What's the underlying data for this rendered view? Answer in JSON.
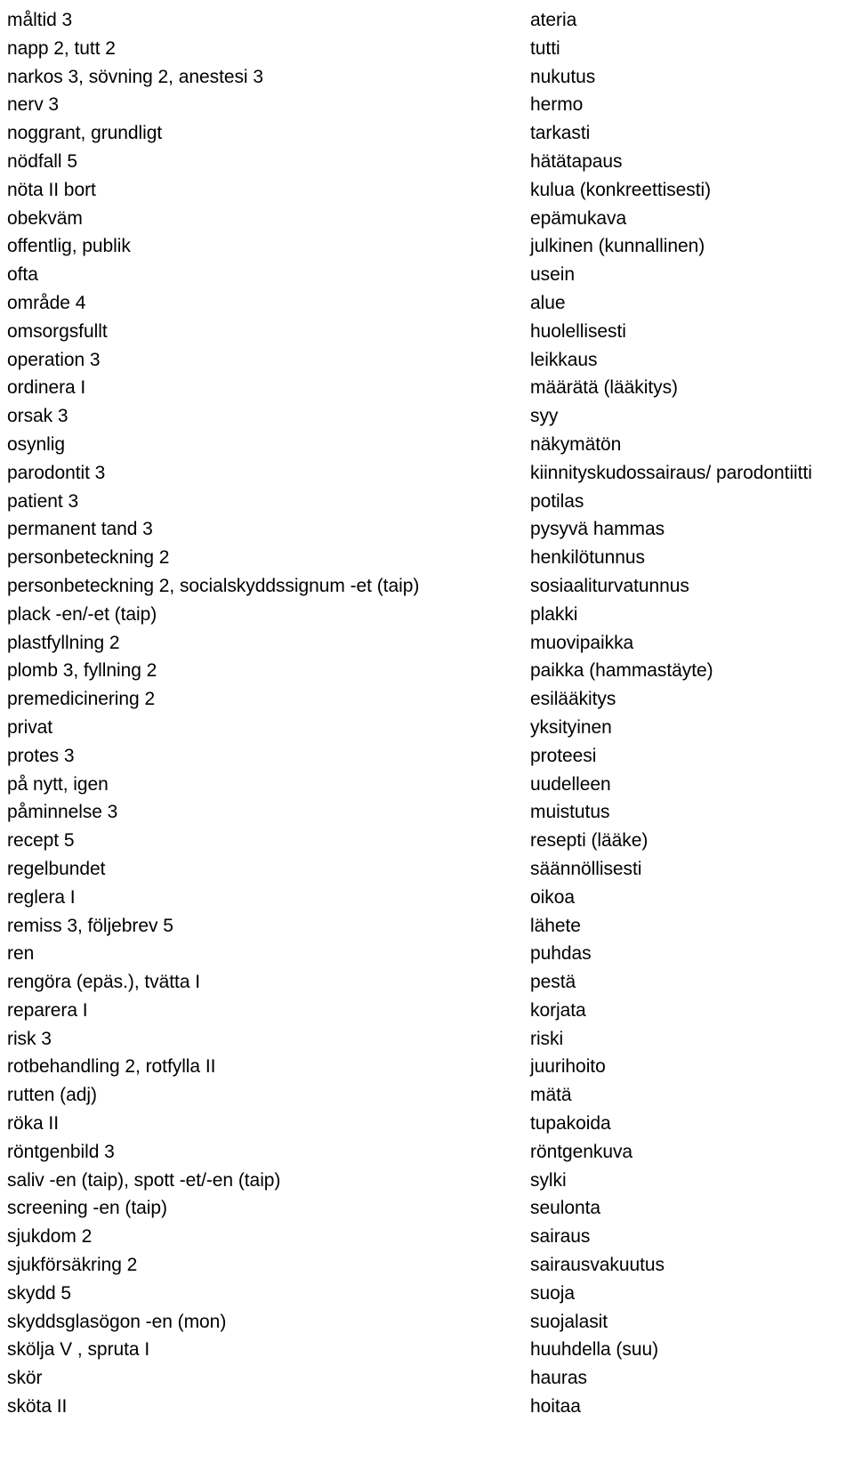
{
  "document": {
    "type": "bilingual-glossary",
    "source_language": "Swedish",
    "target_language": "Finnish",
    "columns": [
      "term",
      "translation"
    ],
    "rows": [
      {
        "term": "måltid 3",
        "translation": "ateria"
      },
      {
        "term": "napp 2, tutt 2",
        "translation": "tutti"
      },
      {
        "term": "narkos 3, sövning 2, anestesi 3",
        "translation": "nukutus"
      },
      {
        "term": "nerv 3",
        "translation": "hermo"
      },
      {
        "term": "noggrant, grundligt",
        "translation": "tarkasti"
      },
      {
        "term": "nödfall 5",
        "translation": "hätätapaus"
      },
      {
        "term": "nöta II bort",
        "translation": "kulua (konkreettisesti)"
      },
      {
        "term": "obekväm",
        "translation": "epämukava"
      },
      {
        "term": "offentlig, publik",
        "translation": "julkinen (kunnallinen)"
      },
      {
        "term": "ofta",
        "translation": "usein"
      },
      {
        "term": "område 4",
        "translation": "alue"
      },
      {
        "term": "omsorgsfullt",
        "translation": "huolellisesti"
      },
      {
        "term": "operation 3",
        "translation": "leikkaus"
      },
      {
        "term": "ordinera I",
        "translation": "määrätä (lääkitys)"
      },
      {
        "term": "orsak 3",
        "translation": "syy"
      },
      {
        "term": "osynlig",
        "translation": "näkymätön"
      },
      {
        "term": "parodontit 3",
        "translation": "kiinnityskudossairaus/ parodontiitti"
      },
      {
        "term": "patient 3",
        "translation": "potilas"
      },
      {
        "term": "permanent tand 3",
        "translation": "pysyvä hammas"
      },
      {
        "term": "personbeteckning 2",
        "translation": "henkilötunnus"
      },
      {
        "term": "personbeteckning 2, socialskyddssignum -et (taip)",
        "translation": "sosiaaliturvatunnus"
      },
      {
        "term": "plack -en/-et (taip)",
        "translation": "plakki"
      },
      {
        "term": "plastfyllning 2",
        "translation": "muovipaikka"
      },
      {
        "term": "plomb 3, fyllning 2",
        "translation": "paikka (hammastäyte)"
      },
      {
        "term": "premedicinering 2",
        "translation": "esilääkitys"
      },
      {
        "term": "privat",
        "translation": "yksityinen"
      },
      {
        "term": "protes 3",
        "translation": "proteesi"
      },
      {
        "term": "på nytt, igen",
        "translation": "uudelleen"
      },
      {
        "term": "påminnelse 3",
        "translation": "muistutus"
      },
      {
        "term": "recept 5",
        "translation": "resepti (lääke)"
      },
      {
        "term": "regelbundet",
        "translation": "säännöllisesti"
      },
      {
        "term": "reglera I",
        "translation": "oikoa"
      },
      {
        "term": "remiss 3, följebrev 5",
        "translation": "lähete"
      },
      {
        "term": "ren",
        "translation": "puhdas"
      },
      {
        "term": "rengöra (epäs.), tvätta I",
        "translation": "pestä"
      },
      {
        "term": "reparera I",
        "translation": "korjata"
      },
      {
        "term": "risk 3",
        "translation": "riski"
      },
      {
        "term": "rotbehandling 2, rotfylla II",
        "translation": "juurihoito"
      },
      {
        "term": "rutten (adj)",
        "translation": "mätä"
      },
      {
        "term": "röka II",
        "translation": "tupakoida"
      },
      {
        "term": "röntgenbild 3",
        "translation": "röntgenkuva"
      },
      {
        "term": "saliv -en (taip), spott -et/-en (taip)",
        "translation": "sylki"
      },
      {
        "term": "screening -en (taip)",
        "translation": "seulonta"
      },
      {
        "term": "sjukdom 2",
        "translation": "sairaus"
      },
      {
        "term": "sjukförsäkring 2",
        "translation": "sairausvakuutus"
      },
      {
        "term": "skydd 5",
        "translation": "suoja"
      },
      {
        "term": "skyddsglasögon -en (mon)",
        "translation": "suojalasit"
      },
      {
        "term": "skölja V , spruta I",
        "translation": "huuhdella (suu)"
      },
      {
        "term": "skör",
        "translation": "hauras"
      },
      {
        "term": "sköta II",
        "translation": "hoitaa"
      }
    ]
  }
}
